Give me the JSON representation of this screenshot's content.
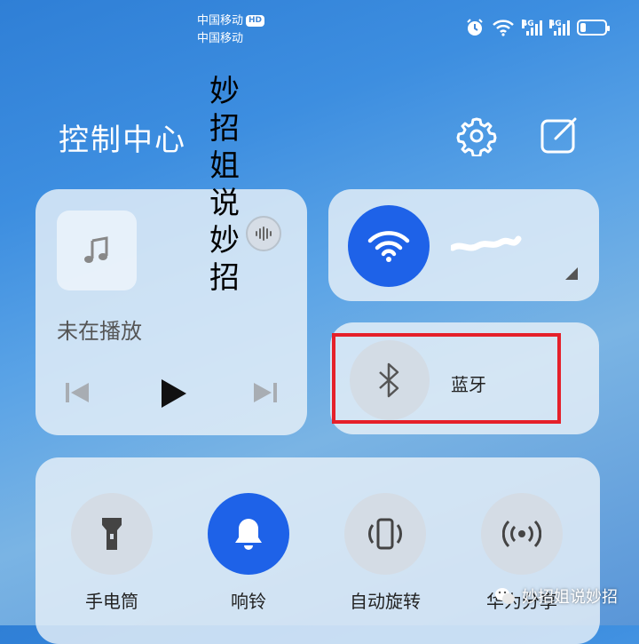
{
  "status_bar": {
    "carrier_1": "中国移动",
    "carrier_1_badge": "HD",
    "carrier_2": "中国移动",
    "network_1": "4G",
    "network_2": "4G",
    "icons": [
      "alarm-icon",
      "wifi-icon",
      "signal-icon",
      "signal-icon",
      "battery-icon"
    ]
  },
  "header": {
    "title": "控制中心",
    "settings_icon": "gear-icon",
    "edit_icon": "edit-icon"
  },
  "overlay_text": "妙招姐说妙招",
  "media_card": {
    "status": "未在播放",
    "controls": [
      "previous-icon",
      "play-icon",
      "next-icon"
    ]
  },
  "wifi_card": {
    "state": "on",
    "network_name_redacted": true
  },
  "bluetooth_card": {
    "label": "蓝牙",
    "state": "off",
    "highlighted": true
  },
  "toggles": [
    {
      "label": "手电筒",
      "icon": "flashlight-icon",
      "state": "off"
    },
    {
      "label": "响铃",
      "icon": "bell-icon",
      "state": "on"
    },
    {
      "label": "自动旋转",
      "icon": "rotate-icon",
      "state": "off"
    },
    {
      "label": "华为分享",
      "icon": "share-icon",
      "state": "off"
    }
  ],
  "watermark": "妙招姐说妙招",
  "colors": {
    "accent": "#1e62e8",
    "highlight_box": "#e5202a"
  }
}
